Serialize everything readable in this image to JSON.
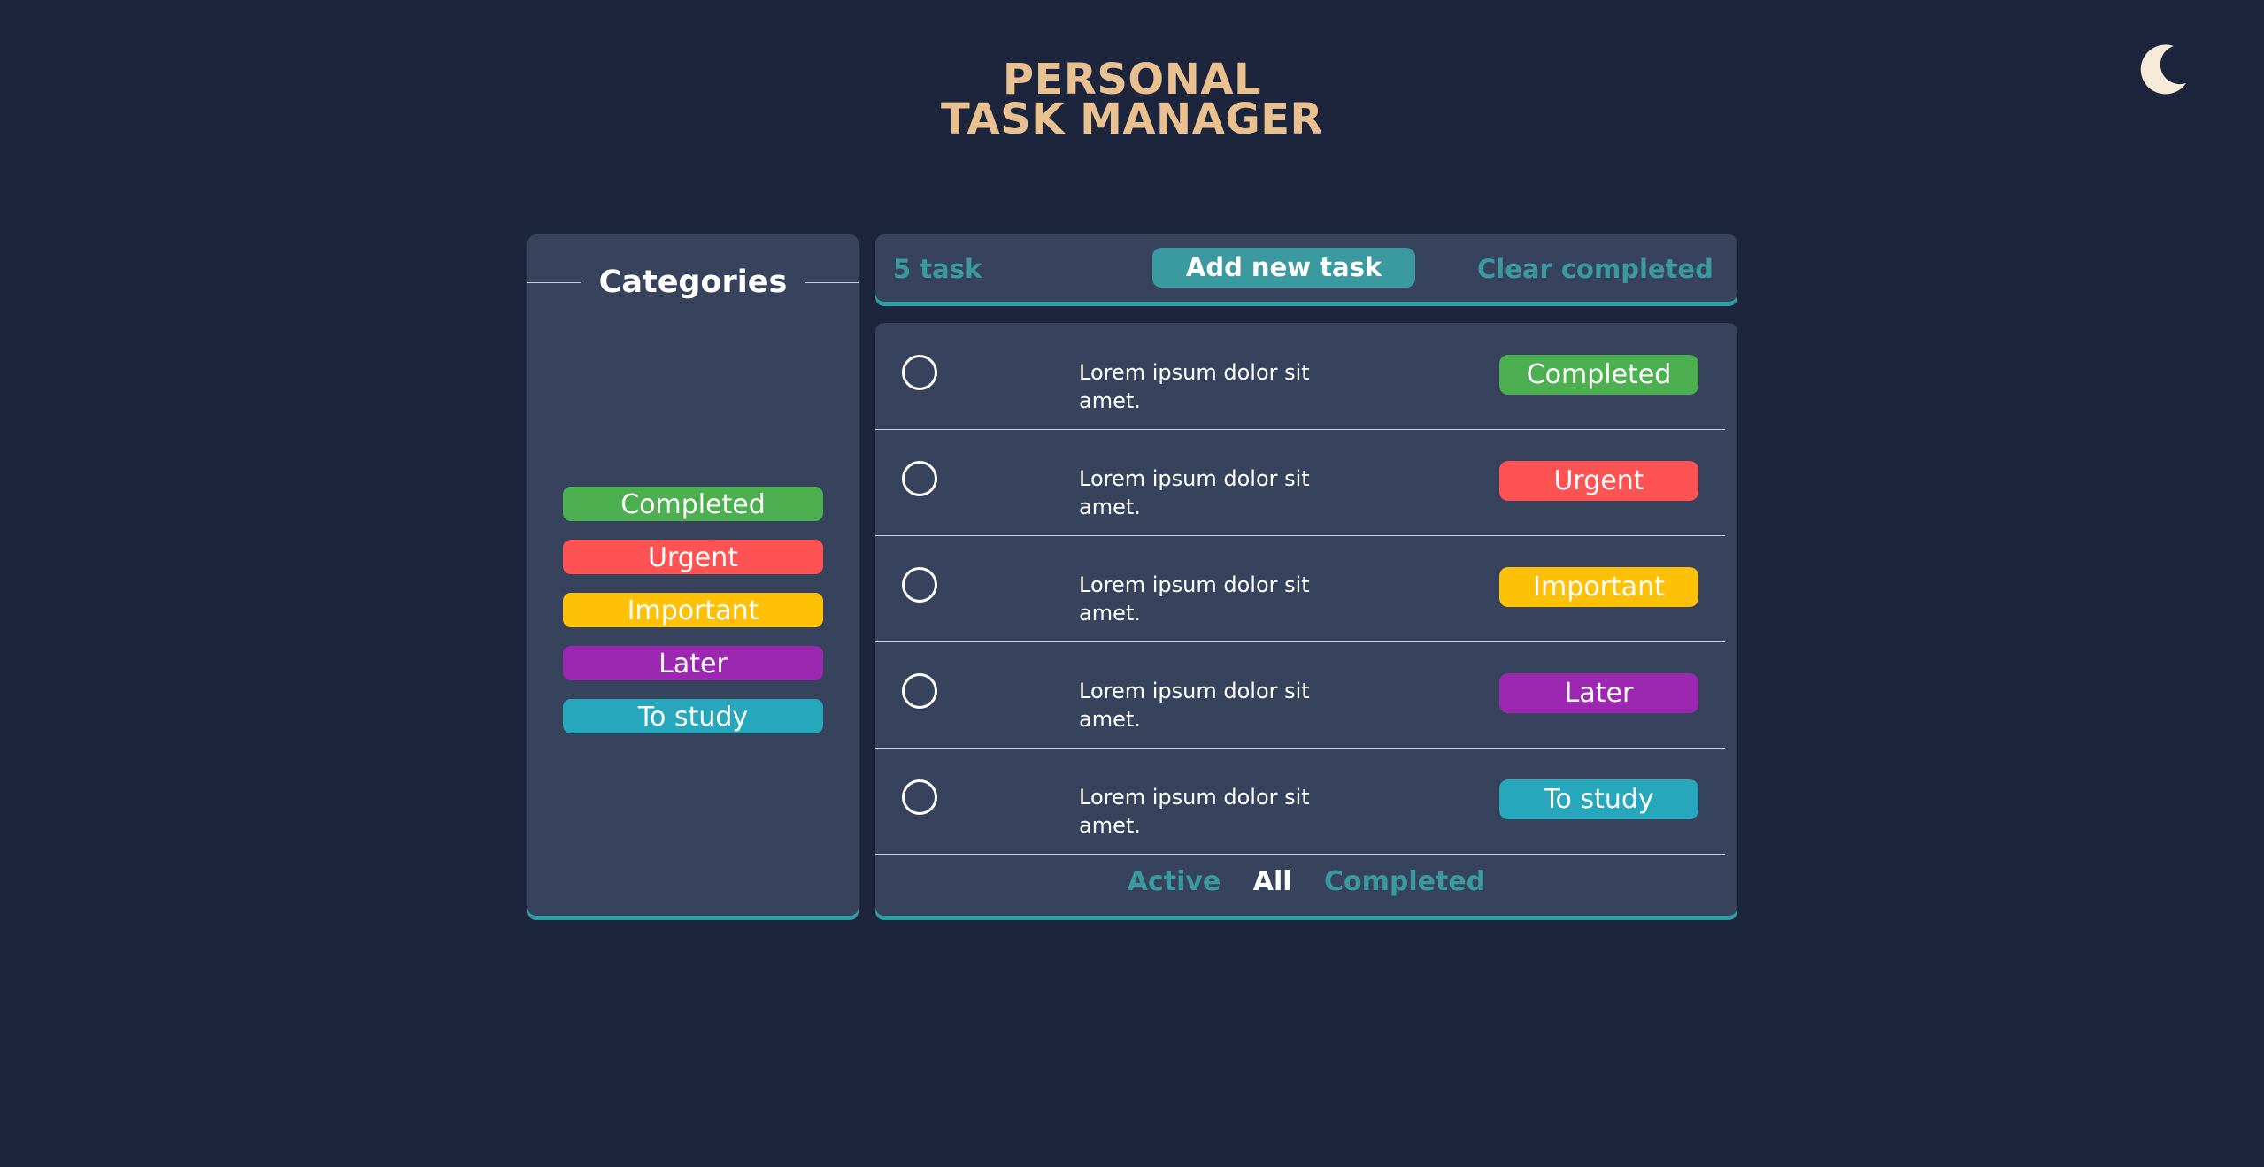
{
  "header": {
    "title_line1": "PERSONAL",
    "title_line2": "TASK MANAGER",
    "theme_icon": "moon-icon"
  },
  "colors": {
    "background": "#1c253b",
    "panel": "#37435c",
    "accent": "#3a9aa0",
    "title": "#e9c191",
    "completed": "#4caf50",
    "urgent": "#ff5252",
    "important": "#ffc107",
    "later": "#9c27b0",
    "to_study": "#26a7bb"
  },
  "categories": {
    "heading": "Categories",
    "items": [
      {
        "label": "Completed",
        "color": "#4caf50"
      },
      {
        "label": "Urgent",
        "color": "#ff5252"
      },
      {
        "label": "Important",
        "color": "#ffc107"
      },
      {
        "label": "Later",
        "color": "#9c27b0"
      },
      {
        "label": "To study",
        "color": "#26a7bb"
      }
    ]
  },
  "toolbar": {
    "task_count": "5 task",
    "add_label": "Add new task",
    "clear_label": "Clear completed"
  },
  "tasks": [
    {
      "text": "Lorem ipsum dolor sit amet.",
      "tag": "Completed",
      "tag_color": "#4caf50",
      "checked": false
    },
    {
      "text": "Lorem ipsum dolor sit amet.",
      "tag": "Urgent",
      "tag_color": "#ff5252",
      "checked": false
    },
    {
      "text": "Lorem ipsum dolor sit amet.",
      "tag": "Important",
      "tag_color": "#ffc107",
      "checked": false
    },
    {
      "text": "Lorem ipsum dolor sit amet.",
      "tag": "Later",
      "tag_color": "#9c27b0",
      "checked": false
    },
    {
      "text": "Lorem ipsum dolor sit amet.",
      "tag": "To study",
      "tag_color": "#26a7bb",
      "checked": false
    }
  ],
  "filters": {
    "active": "Active",
    "all": "All",
    "completed": "Completed",
    "selected": "All"
  }
}
